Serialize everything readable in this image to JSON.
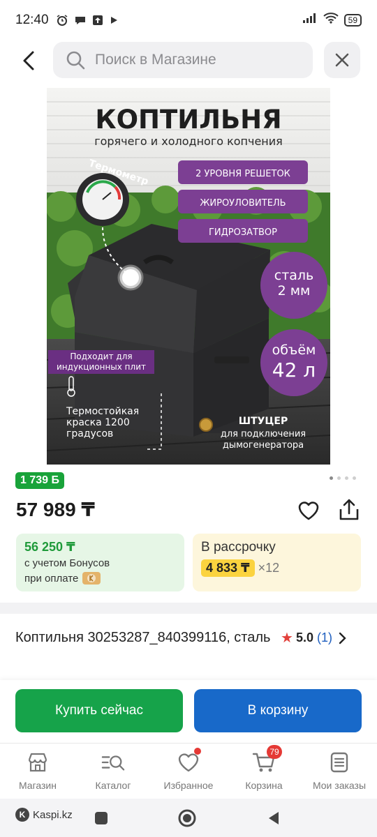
{
  "status_bar": {
    "time": "12:40",
    "battery": "59",
    "icons": [
      "alarm-icon",
      "chat-icon",
      "upload-icon",
      "play-icon",
      "signal-icon",
      "wifi-icon",
      "battery-icon"
    ]
  },
  "search": {
    "placeholder": "Поиск в Магазине"
  },
  "product_image": {
    "headline": "КОПТИЛЬНЯ",
    "subheadline": "горячего и холодного копчения",
    "thermometer_label": "Термометр",
    "features": [
      "2 УРОВНЯ РЕШЕТОК",
      "ЖИРОУЛОВИТЕЛЬ",
      "ГИДРОЗАТВОР"
    ],
    "steel": "сталь\n2 мм",
    "steel_line1": "сталь",
    "steel_line2": "2 мм",
    "volume_line1": "объём",
    "volume_line2": "42 л",
    "induction_line1": "Подходит для",
    "induction_line2": "индукционных плит",
    "paint_line1": "Термостойкая",
    "paint_line2": "краска 1200",
    "paint_line3": "градусов",
    "fitting_title": "ШТУЦЕР",
    "fitting_line1": "для подключения",
    "fitting_line2": "дымогенератора",
    "colors": {
      "purple": "#7c3f93",
      "purple_dark": "#6a2f82",
      "smoker": "#2e2e30"
    }
  },
  "bonus_badge": "1 739 Б",
  "price": "57 989 ₸",
  "bonus_card": {
    "price": "56 250 ₸",
    "line1": "с учетом Бонусов",
    "line2": "при оплате"
  },
  "installment": {
    "title": "В рассрочку",
    "amount": "4 833 ₸",
    "multiplier": "×12"
  },
  "product": {
    "title": "Коптильня 30253287_840399116, сталь",
    "rating": "5.0",
    "reviews": "(1)"
  },
  "actions": {
    "buy_now": "Купить сейчас",
    "add_to_cart": "В корзину"
  },
  "tabs": [
    {
      "label": "Магазин",
      "icon": "store-icon"
    },
    {
      "label": "Каталог",
      "icon": "catalog-icon"
    },
    {
      "label": "Избранное",
      "icon": "heart-icon"
    },
    {
      "label": "Корзина",
      "icon": "cart-icon",
      "badge": "79"
    },
    {
      "label": "Мои заказы",
      "icon": "orders-icon"
    }
  ],
  "nav": {
    "brand": "Kaspi.kz"
  },
  "colors": {
    "green": "#16a34a",
    "blue": "#1869c9",
    "bonus_bg": "#e6f6e6",
    "installment_bg": "#fdf6dc",
    "installment_accent": "#fbd33f",
    "badge_red": "#e53935"
  }
}
